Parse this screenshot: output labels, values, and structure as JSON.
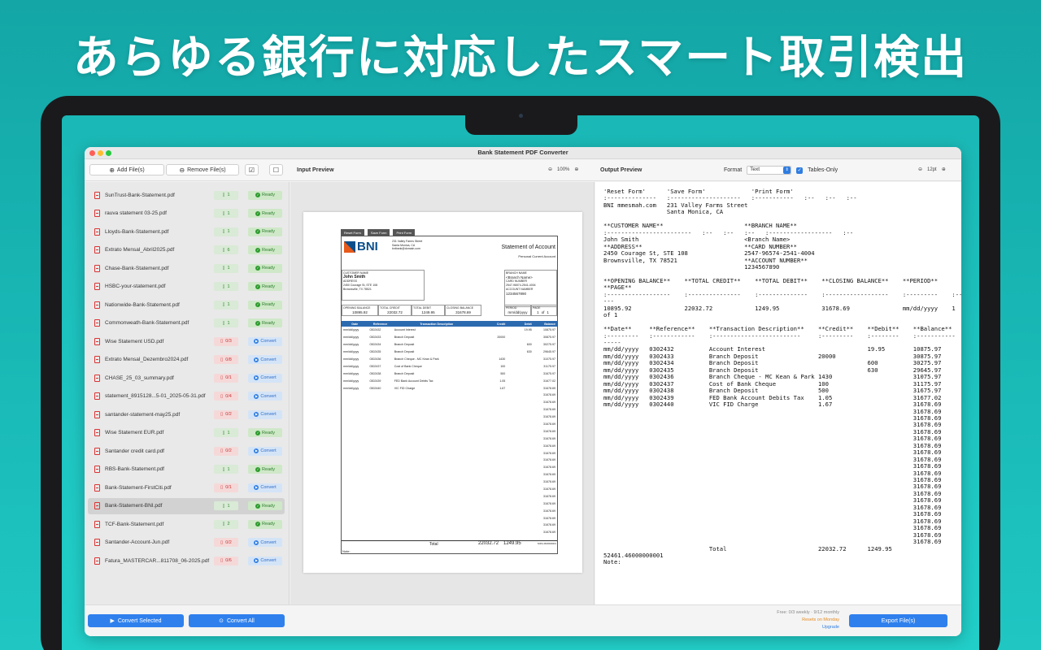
{
  "headline": "あらゆる銀行に対応したスマート取引検出",
  "window": {
    "title": "Bank Statement PDF Converter"
  },
  "toolbar": {
    "add_files": "Add File(s)",
    "remove_files": "Remove File(s)",
    "input_preview": "Input Preview",
    "input_zoom": "100%",
    "output_preview": "Output Preview",
    "format_label": "Format",
    "format_value": "Text",
    "tables_only": "Tables-Only",
    "font_size": "12pt"
  },
  "files": [
    {
      "name": "SunTrust-Bank-Statement.pdf",
      "pages": "1",
      "pages_ok": true,
      "status": "Ready"
    },
    {
      "name": "rauva statement 03-25.pdf",
      "pages": "1",
      "pages_ok": true,
      "status": "Ready"
    },
    {
      "name": "Lloyds-Bank-Statement.pdf",
      "pages": "1",
      "pages_ok": true,
      "status": "Ready"
    },
    {
      "name": "Extrato Mensal_Abril2025.pdf",
      "pages": "6",
      "pages_ok": true,
      "status": "Ready"
    },
    {
      "name": "Chase-Bank-Statement.pdf",
      "pages": "1",
      "pages_ok": true,
      "status": "Ready"
    },
    {
      "name": "HSBC-your-statement.pdf",
      "pages": "1",
      "pages_ok": true,
      "status": "Ready"
    },
    {
      "name": "Nationwide-Bank-Statement.pdf",
      "pages": "1",
      "pages_ok": true,
      "status": "Ready"
    },
    {
      "name": "Commonweath-Bank-Statement.pdf",
      "pages": "1",
      "pages_ok": true,
      "status": "Ready"
    },
    {
      "name": "Wise Statement USD.pdf",
      "pages": "0/3",
      "pages_ok": false,
      "status": "Convert"
    },
    {
      "name": "Extrato Mensal_Dezembro2024.pdf",
      "pages": "0/8",
      "pages_ok": false,
      "status": "Convert"
    },
    {
      "name": "CHASE_25_03_summary.pdf",
      "pages": "0/1",
      "pages_ok": false,
      "status": "Convert"
    },
    {
      "name": "statement_8915128...5-01_2025-05-31.pdf",
      "pages": "0/4",
      "pages_ok": false,
      "status": "Convert"
    },
    {
      "name": "santander-statement-may25.pdf",
      "pages": "0/2",
      "pages_ok": false,
      "status": "Convert"
    },
    {
      "name": "Wise Statement EUR.pdf",
      "pages": "1",
      "pages_ok": true,
      "status": "Ready"
    },
    {
      "name": "Santander credit card.pdf",
      "pages": "0/2",
      "pages_ok": false,
      "status": "Convert"
    },
    {
      "name": "RBS-Bank-Statement.pdf",
      "pages": "1",
      "pages_ok": true,
      "status": "Ready"
    },
    {
      "name": "Bank-Statement-FirstCiti.pdf",
      "pages": "0/1",
      "pages_ok": false,
      "status": "Convert"
    },
    {
      "name": "Bank-Statement-BNI.pdf",
      "pages": "1",
      "pages_ok": true,
      "status": "Ready"
    },
    {
      "name": "TCF-Bank-Statement.pdf",
      "pages": "2",
      "pages_ok": true,
      "status": "Ready"
    },
    {
      "name": "Santander-Account-Jun.pdf",
      "pages": "0/2",
      "pages_ok": false,
      "status": "Convert"
    },
    {
      "name": "Fatura_MASTERCAR...811708_06-2025.pdf",
      "pages": "0/6",
      "pages_ok": false,
      "status": "Convert"
    }
  ],
  "selected_file_index": 17,
  "document": {
    "buttons": [
      "Reset Form",
      "Save Form",
      "Print Form"
    ],
    "bank": "BNI",
    "bank_address": [
      "231 Valley Farms Street",
      "Santa Monica, CA",
      "bnibank@domain.com"
    ],
    "statement_title": "Statement of Account",
    "account_type": "Personal Current Account",
    "customer_name_label": "CUSTOMER NAME",
    "customer_name": "John Smith",
    "address_label": "ADDRESS",
    "address": [
      "2450 Courage St, STE 108",
      "Brownsville, TX 78521"
    ],
    "branch_name_label": "BRANCH NAME",
    "branch_name": "<Branch Name>",
    "card_number_label": "CARD NUMBER",
    "card_number": "2547-96574-2541-4004",
    "account_number_label": "ACCOUNT NUMBER",
    "account_number": "1234567890",
    "summary_labels": [
      "OPENING BALANCE",
      "TOTAL CREDIT",
      "TOTAL DEBIT",
      "CLOSING BALANCE",
      "PERIOD",
      "PAGE"
    ],
    "summary_values": [
      "10895.92",
      "22032.72",
      "1249.95",
      "31678.69",
      "mm/dd/yyyy",
      "1",
      "of",
      "1"
    ],
    "columns": [
      "Date",
      "Reference",
      "Transaction Description",
      "Credit",
      "Debit",
      "Balance"
    ],
    "rows": [
      [
        "mm/dd/yyyy",
        "0302432",
        "Account Interest",
        "",
        "19.95",
        "10875.97"
      ],
      [
        "mm/dd/yyyy",
        "0302433",
        "Branch Deposit",
        "20000",
        "",
        "30875.97"
      ],
      [
        "mm/dd/yyyy",
        "0302434",
        "Branch Deposit",
        "",
        "600",
        "30275.97"
      ],
      [
        "mm/dd/yyyy",
        "0302435",
        "Branch Deposit",
        "",
        "630",
        "29645.97"
      ],
      [
        "mm/dd/yyyy",
        "0302436",
        "Branch Cheque - MC Kean & Park",
        "1430",
        "",
        "31075.97"
      ],
      [
        "mm/dd/yyyy",
        "0302437",
        "Cost of Bank Cheque",
        "100",
        "",
        "31175.97"
      ],
      [
        "mm/dd/yyyy",
        "0302438",
        "Branch Deposit",
        "500",
        "",
        "31675.97"
      ],
      [
        "mm/dd/yyyy",
        "0302439",
        "FED Bank Account Debits Tax",
        "1.05",
        "",
        "31677.02"
      ],
      [
        "mm/dd/yyyy",
        "0302440",
        "VIC FID Charge",
        "1.67",
        "",
        "31678.69"
      ]
    ],
    "trailing_balance": "31678.69",
    "total_label": "Total",
    "total_credit": "22032.72",
    "total_debit": "1249.95",
    "total_note": "52461.46000000001",
    "note_label": "Note:"
  },
  "output_text": "'Reset Form'      'Save Form'             'Print Form'\n:--------------   :--------------------   :-----------   :--   :--   :--\nBNI mmesmah.com   231 Valley Farms Street\n                  Santa Monica, CA\n\n**CUSTOMER NAME**                       **BRANCH NAME**\n:------------------------   :--   :--   :--   :------------------   :--\nJohn Smith                              <Branch Name>\n**ADDRESS**                             **CARD NUMBER**\n2450 Courage St, STE 108                2547-96574-2541-4004\nBrownsville, TX 78521                   **ACCOUNT NUMBER**\n                                        1234567890\n\n**OPENING BALANCE**    **TOTAL CREDIT**    **TOTAL DEBIT**    **CLOSING BALANCE**    **PERIOD**    \n**PAGE**\n:------------------    :---------------    :--------------    :------------------    :---------    :----\n---\n10895.92               22032.72            1249.95            31678.69               mm/dd/yyyy    1\nof 1\n\n**Date**     **Reference**    **Transaction Description**    **Credit**    **Debit**    **Balance**\n:---------   :------------    :-------------------------     :---------    :--------    :-----------\n-----\nmm/dd/yyyy   0302432          Account Interest                             19.95        10875.97\nmm/dd/yyyy   0302433          Branch Deposit                 20000                      30875.97\nmm/dd/yyyy   0302434          Branch Deposit                               600          30275.97\nmm/dd/yyyy   0302435          Branch Deposit                               630          29645.97\nmm/dd/yyyy   0302436          Branch Cheque - MC Kean & Park 1430                       31075.97\nmm/dd/yyyy   0302437          Cost of Bank Cheque            100                        31175.97\nmm/dd/yyyy   0302438          Branch Deposit                 500                        31675.97\nmm/dd/yyyy   0302439          FED Bank Account Debits Tax    1.05                       31677.02\nmm/dd/yyyy   0302440          VIC FID Charge                 1.67                       31678.69\n                                                                                        31678.69\n                                                                                        31678.69\n                                                                                        31678.69\n                                                                                        31678.69\n                                                                                        31678.69\n                                                                                        31678.69\n                                                                                        31678.69\n                                                                                        31678.69\n                                                                                        31678.69\n                                                                                        31678.69\n                                                                                        31678.69\n                                                                                        31678.69\n                                                                                        31678.69\n                                                                                        31678.69\n                                                                                        31678.69\n                                                                                        31678.69\n                                                                                        31678.69\n                                                                                        31678.69\n                                                                                        31678.69\n                                                                                        31678.69\n                              Total                          22032.72      1249.95\n52461.46000000001\nNote:",
  "bottom": {
    "convert_selected": "Convert Selected",
    "convert_all": "Convert All",
    "quota_free": "Free: 0/3 weekly · 9/12 monthly",
    "quota_reset": "Resets on Monday",
    "upgrade": "Upgrade",
    "export": "Export File(s)"
  },
  "colors": {
    "accent": "#2f80ed",
    "ready": "#2e9b2e",
    "error": "#cc3333",
    "bni_blue": "#0a4f8c"
  }
}
